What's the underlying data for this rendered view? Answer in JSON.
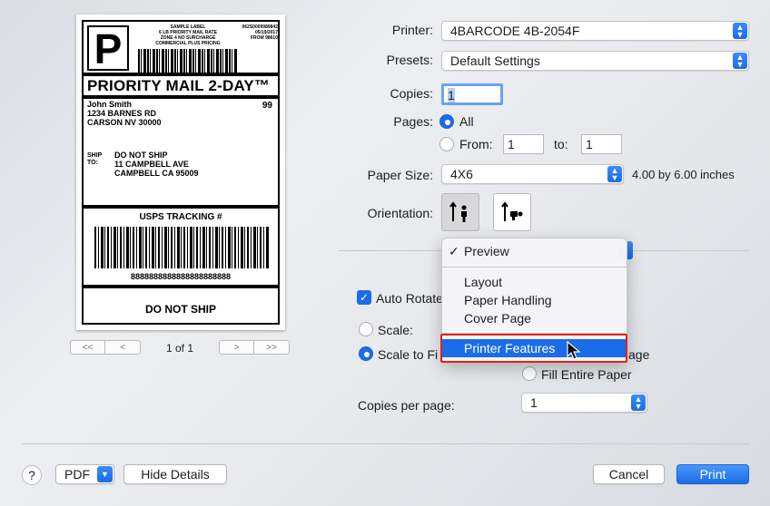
{
  "preview": {
    "label": {
      "big_letter": "P",
      "sample_lines": [
        "SAMPLE LABEL",
        "6 LB PRIORITY MAIL RATE",
        "ZONE 4 NO SURCHARGE",
        "COMMERCIAL PLUS PRICING"
      ],
      "code_lines": [
        "062S0009989842",
        "05/19/2017",
        "FROM 98610"
      ],
      "service": "PRIORITY MAIL 2-DAY™",
      "from_lines": [
        "John Smith",
        "1234 BARNES RD",
        "CARSON NV 30000"
      ],
      "zone": "99",
      "ship_to_label": "SHIP\nTO:",
      "to_lines": [
        "DO NOT SHIP",
        "11 CAMPBELL AVE",
        "CAMPBELL CA 95009"
      ],
      "tracking_title": "USPS TRACKING #",
      "tracking_number": "8888888888888888888888",
      "footer": "DO NOT SHIP"
    },
    "pager": {
      "first": "<<",
      "prev": "<",
      "page_text": "1 of 1",
      "next": ">",
      "last": ">>"
    }
  },
  "form": {
    "printer_label": "Printer:",
    "printer_value": "4BARCODE 4B-2054F",
    "presets_label": "Presets:",
    "presets_value": "Default Settings",
    "copies_label": "Copies:",
    "copies_value": "1",
    "pages_label": "Pages:",
    "pages_all": "All",
    "pages_from": "From:",
    "pages_from_value": "1",
    "pages_to": "to:",
    "pages_to_value": "1",
    "paper_size_label": "Paper Size:",
    "paper_size_value": "4X6",
    "paper_size_desc": "4.00 by 6.00 inches",
    "orientation_label": "Orientation:",
    "auto_rotate": "Auto Rotate",
    "scale": "Scale:",
    "scale_to_fit": "Scale to Fi",
    "scale_to_fit_tail": "age",
    "fill_entire_paper": "Fill Entire Paper",
    "copies_per_page_label": "Copies per page:",
    "copies_per_page_value": "1"
  },
  "menu": {
    "items": [
      {
        "label": "Preview",
        "checked": "✓"
      },
      {
        "label": "Layout"
      },
      {
        "label": "Paper Handling"
      },
      {
        "label": "Cover Page"
      },
      {
        "label": "Printer Features"
      }
    ]
  },
  "footer": {
    "help": "?",
    "pdf": "PDF",
    "hide_details": "Hide Details",
    "cancel": "Cancel",
    "print": "Print"
  },
  "colors": {
    "accent": "#1b6ce8",
    "highlight_box": "#e2221a"
  }
}
